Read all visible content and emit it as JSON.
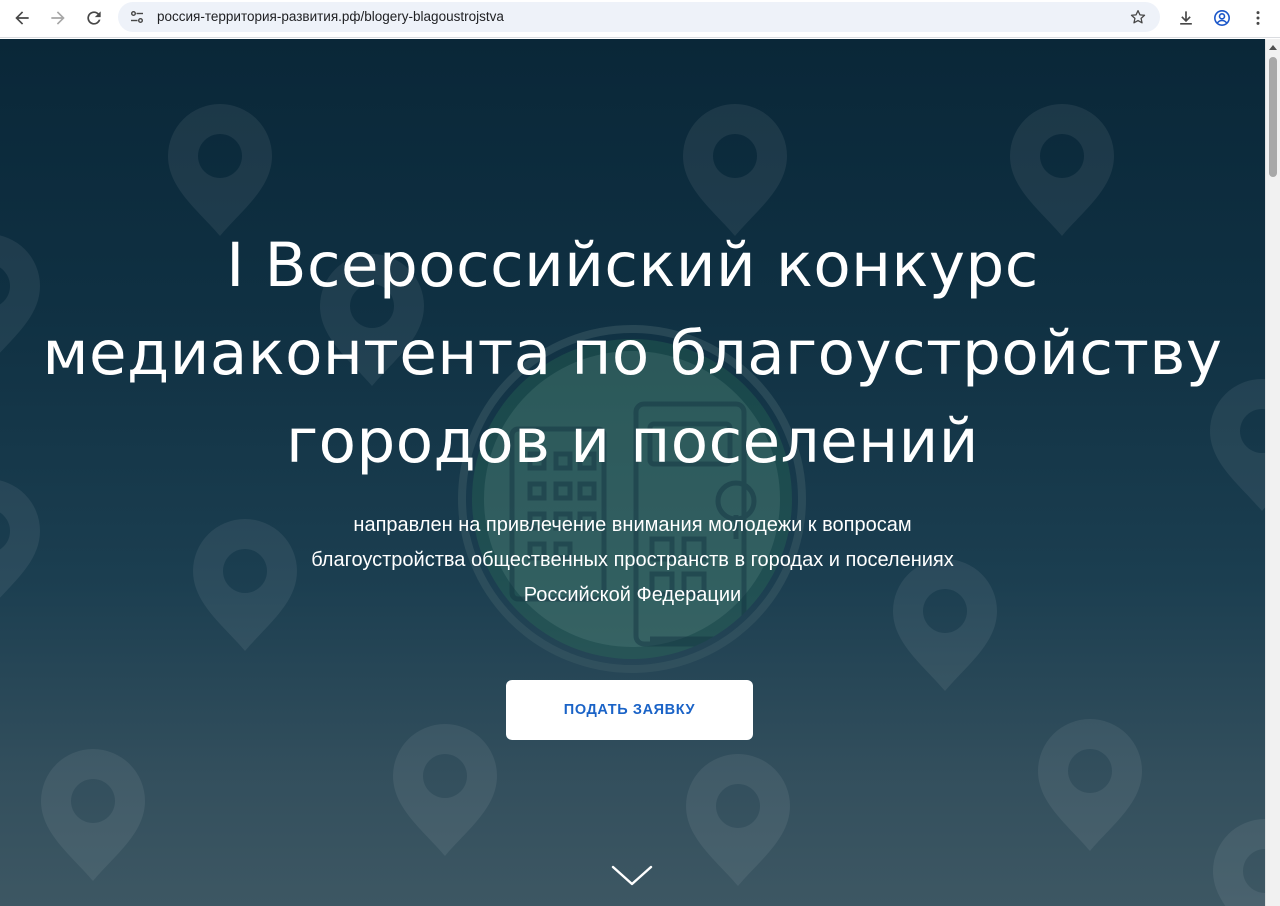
{
  "browser": {
    "url": "россия-территория-развития.рф/blogery-blagoustrojstva",
    "icons": {
      "back": "arrow-left-icon",
      "forward": "arrow-right-icon",
      "reload": "reload-icon",
      "site_info": "tune-icon",
      "bookmark": "star-icon",
      "download": "download-icon",
      "profile": "account-circle-icon",
      "menu": "kebab-menu-icon"
    }
  },
  "hero": {
    "title_lines": [
      "I Всероссийский конкурс",
      "медиаконтента по благоустройству",
      "городов и поселений"
    ],
    "subtitle_lines": [
      "направлен на привлечение внимания молодежи к вопросам",
      "благоустройства общественных пространств в городах и поселениях",
      "Российской Федерации"
    ],
    "cta_label": "ПОДАТЬ ЗАЯВКУ",
    "scroll_icon": "chevron-down-icon",
    "pattern_icon": "map-pin-icon",
    "emblem_icon": "city-emblem-icon"
  },
  "colors": {
    "hero_top": "#0a2738",
    "hero_bottom": "#3d5763",
    "cta_text": "#1a63c7",
    "cta_bg": "#ffffff",
    "emblem_ring": "#2e7d5b"
  }
}
